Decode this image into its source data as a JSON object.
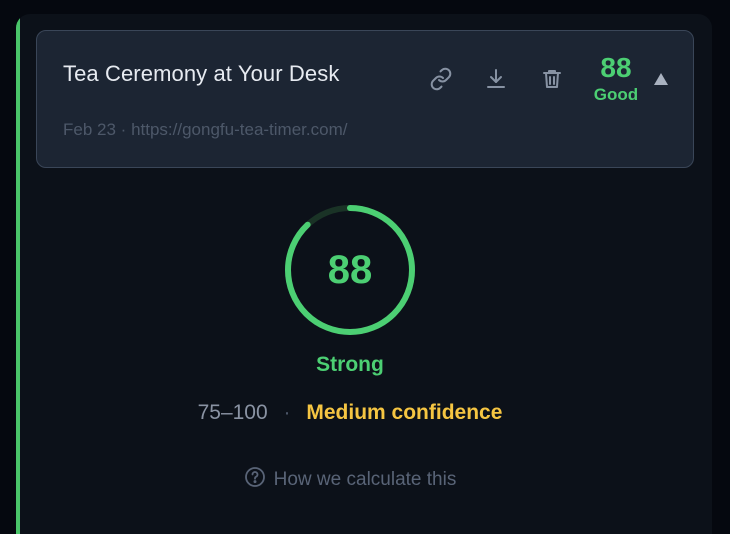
{
  "card": {
    "title": "Tea Ceremony at Your Desk",
    "date": "Feb 23",
    "separator": "·",
    "url": "https://gongfu-tea-timer.com/",
    "score": "88",
    "score_label": "Good",
    "icons": [
      "link-icon",
      "download-icon",
      "trash-icon",
      "collapse-triangle-icon"
    ]
  },
  "summary": {
    "score": "88",
    "score_fraction": 0.88,
    "strength_label": "Strong",
    "range": "75–100",
    "separator": "·",
    "confidence": "Medium confidence",
    "help_text": "How we calculate this",
    "help_icon": "question-circle-icon"
  },
  "colors": {
    "accent_green": "#4ccf73",
    "confidence_yellow": "#f5c542",
    "card_bg": "#1c2533",
    "panel_bg": "#0c1119"
  }
}
